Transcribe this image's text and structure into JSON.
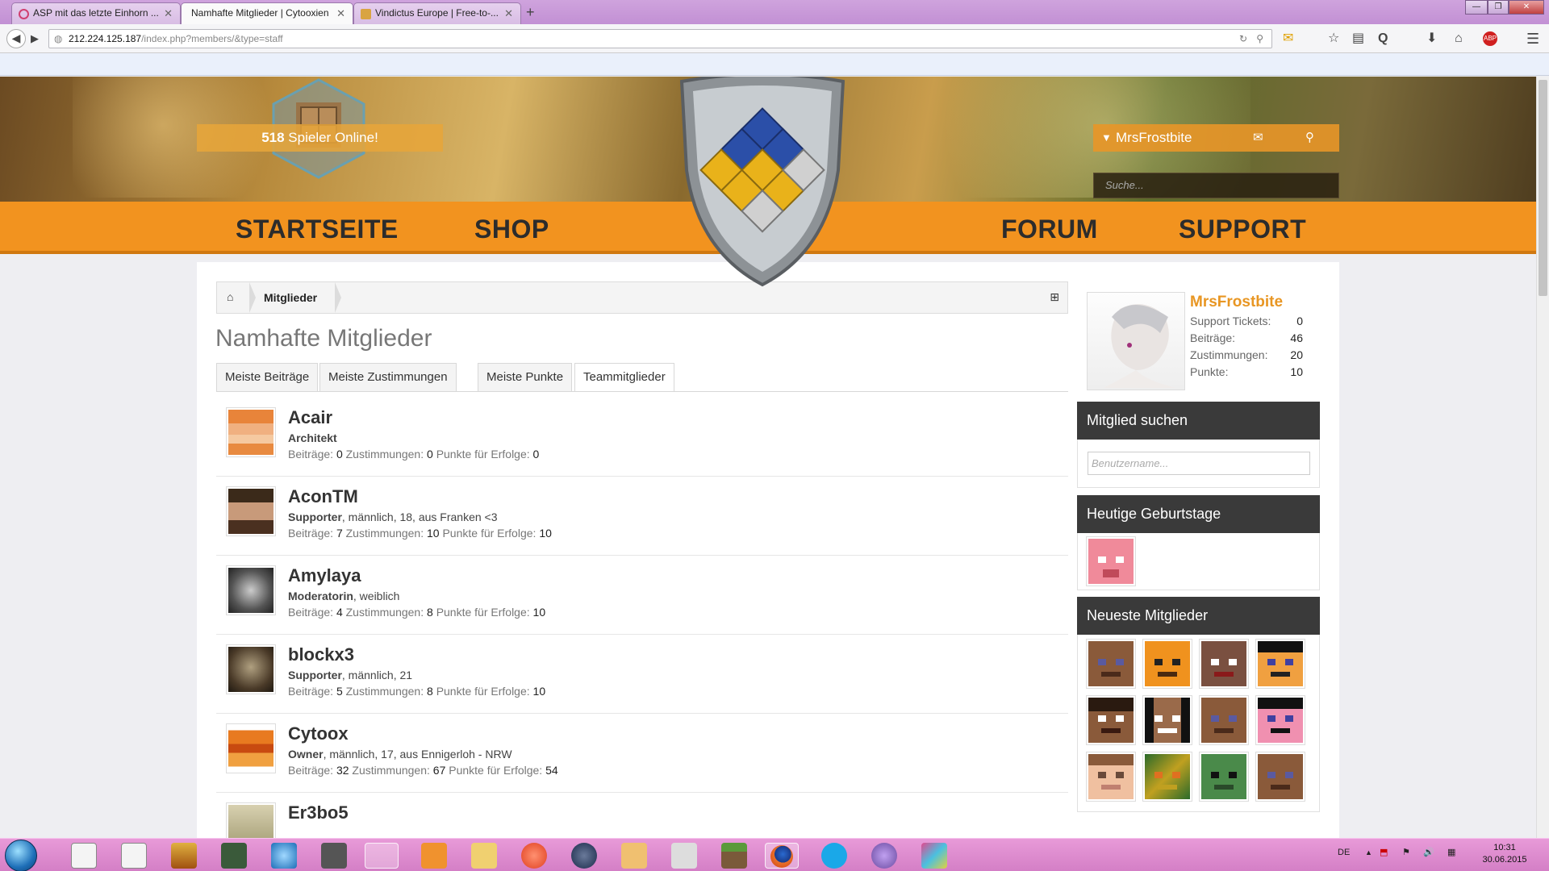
{
  "browser": {
    "tabs": [
      {
        "label": "ASP mit das letzte Einhorn ...",
        "active": false
      },
      {
        "label": "Namhafte Mitglieder | Cytooxien",
        "active": true
      },
      {
        "label": "Vindictus Europe | Free-to-...",
        "active": false
      }
    ],
    "url_host": "212.224.125.187",
    "url_path": "/index.php?members/&type=staff"
  },
  "site": {
    "online_count": "518",
    "online_text": "Spieler Online!",
    "username": "MrsFrostbite",
    "search_placeholder": "Suche...",
    "menu": {
      "home": "STARTSEITE",
      "shop": "SHOP",
      "forum": "FORUM",
      "support": "SUPPORT"
    }
  },
  "breadcrumb": {
    "label": "Mitglieder"
  },
  "page_title": "Namhafte Mitglieder",
  "tabs": [
    "Meiste Beiträge",
    "Meiste Zustimmungen",
    "Meiste Punkte",
    "Teammitglieder"
  ],
  "stat_labels": {
    "posts": "Beiträge:",
    "likes": "Zustimmungen:",
    "points": "Punkte für Erfolge:"
  },
  "members": [
    {
      "name": "Acair",
      "role": "Architekt",
      "extra": "",
      "posts": "0",
      "likes": "0",
      "points": "0"
    },
    {
      "name": "AconTM",
      "role": "Supporter",
      "extra": ", männlich, 18, aus Franken <3",
      "posts": "7",
      "likes": "10",
      "points": "10"
    },
    {
      "name": "Amylaya",
      "role": "Moderatorin",
      "extra": ", weiblich",
      "posts": "4",
      "likes": "8",
      "points": "10"
    },
    {
      "name": "blockx3",
      "role": "Supporter",
      "extra": ", männlich, 21",
      "posts": "5",
      "likes": "8",
      "points": "10"
    },
    {
      "name": "Cytoox",
      "role": "Owner",
      "extra": ", männlich, 17, aus Ennigerloh - NRW",
      "posts": "32",
      "likes": "67",
      "points": "54"
    },
    {
      "name": "Er3bo5",
      "role": "",
      "extra": "",
      "posts": "",
      "likes": "",
      "points": ""
    }
  ],
  "sidebar": {
    "user": {
      "name": "MrsFrostbite",
      "rows": [
        {
          "label": "Support Tickets:",
          "value": "0"
        },
        {
          "label": "Beiträge:",
          "value": "46"
        },
        {
          "label": "Zustimmungen:",
          "value": "20"
        },
        {
          "label": "Punkte:",
          "value": "10"
        }
      ]
    },
    "search_title": "Mitglied suchen",
    "search_placeholder": "Benutzername...",
    "birthdays_title": "Heutige Geburtstage",
    "newest_title": "Neueste Mitglieder"
  },
  "taskbar": {
    "lang": "DE",
    "time": "10:31",
    "date": "30.06.2015"
  },
  "colors": {
    "accent_orange": "#f2931f",
    "username_orange": "#e89623",
    "sidebar_header": "#3a3a3a",
    "taskbar_pink": "#d47fc6"
  }
}
